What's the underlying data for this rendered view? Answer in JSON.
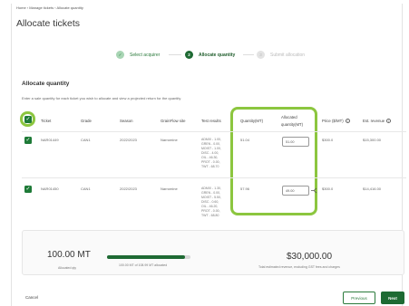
{
  "breadcrumb": "Home  ‹  Manage tickets  ‹  Allocate quantity",
  "page_title": "Allocate tickets",
  "steps": [
    {
      "num": "✓",
      "label": "Select acquirer"
    },
    {
      "num": "2",
      "label": "Allocate quantity"
    },
    {
      "num": "3",
      "label": "Submit allocation"
    }
  ],
  "section": {
    "title": "Allocate quantity",
    "description": "Enter a sale quantity for each ticket you wish to allocate and view a projected return for the quantity"
  },
  "table": {
    "headers": {
      "ticket": "Ticket",
      "grade": "Grade",
      "season": "Season",
      "site": "GrainFlow site",
      "test_results": "Test results",
      "quantity": "Quantity(MT)",
      "allocated": [
        "Allocated",
        "quantity(MT)"
      ],
      "price": "Price ($/MT)",
      "revenue": "Est. revenue"
    },
    "rows": [
      {
        "ticket": "NAR01449",
        "grade": "CAN1",
        "season": "2022/2023",
        "site": "Narromine",
        "test_results": [
          "ADMIX - 1.00,",
          "GREN - 0.00,",
          "MOIST - 1.00,",
          "DISC - 4.00,",
          "OIL - 46.30,",
          "PROT - 0.00,",
          "TWT - 68.70"
        ],
        "quantity": "51.04",
        "allocated": "51.00",
        "price": "$300.0",
        "revenue": "$15,300.00"
      },
      {
        "ticket": "NAR01450",
        "grade": "CAN1",
        "season": "2022/2023",
        "site": "Narromine",
        "test_results": [
          "ADMIX - 1.30,",
          "GREN - 0.00,",
          "MOIST - 5.50,",
          "DISC - 0.60,",
          "OIL - 46.20,",
          "PROT - 0.00,",
          "TWT - 68.80"
        ],
        "quantity": "57.96",
        "allocated": "49.00",
        "price": "$300.0",
        "revenue": "$14,416.00"
      }
    ]
  },
  "summary": {
    "total_mt": "100.00 MT",
    "total_mt_label": "Allocated qty",
    "progress_fraction": 0.93,
    "progress_label": "100.00 MT of 108.99 MT allocated",
    "revenue": "$30,000.00",
    "revenue_label": "Total estimated revenue, excluding GST fees and charges"
  },
  "footer": {
    "cancel": "Cancel",
    "previous": "Previous",
    "next": "Next"
  },
  "colors": {
    "primary": "#1e6a33",
    "highlight": "#8cc63f"
  }
}
